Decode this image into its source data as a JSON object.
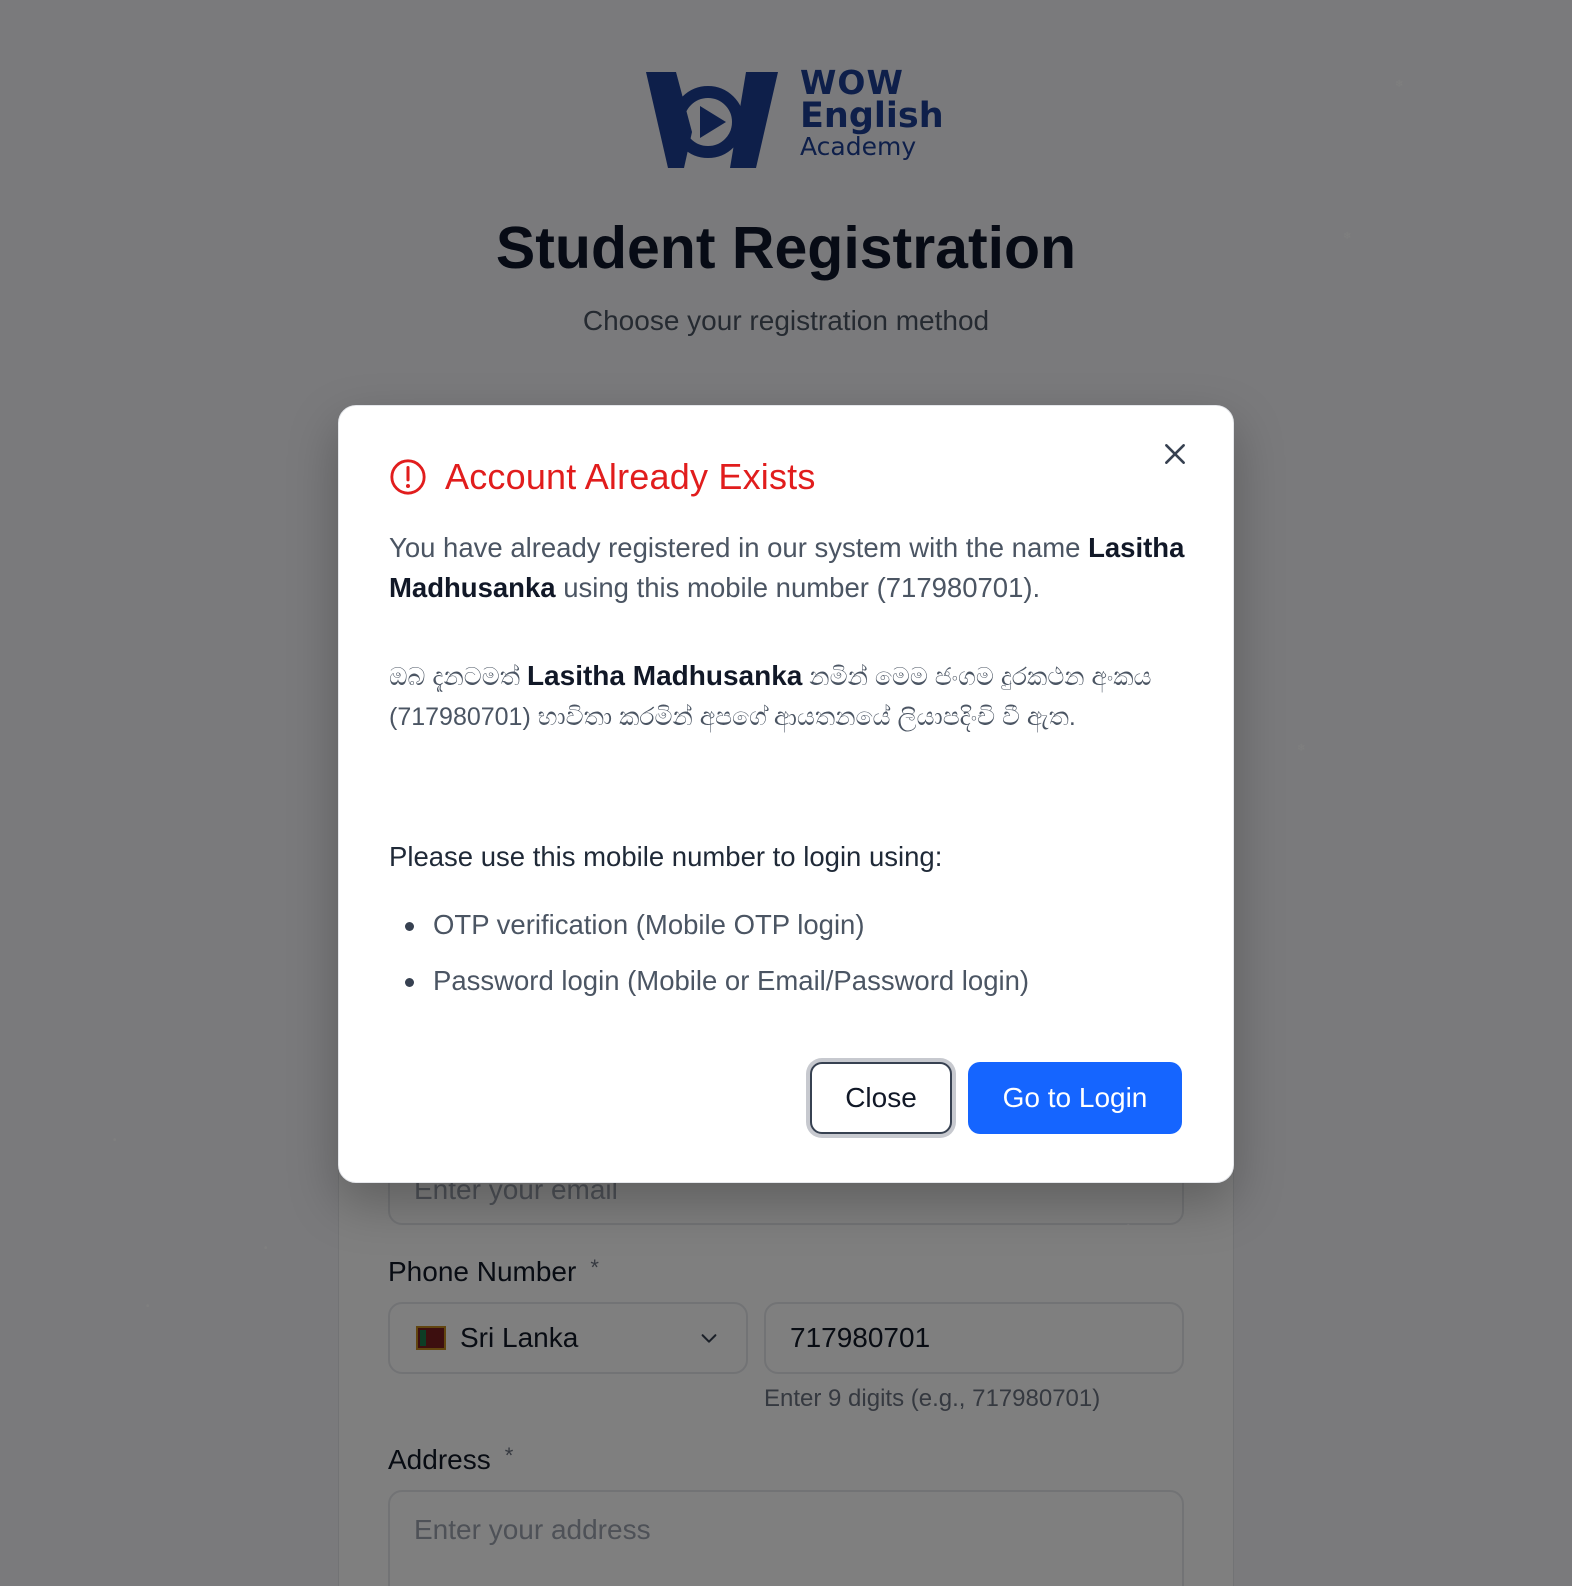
{
  "brand": {
    "line1": "WOW",
    "line2": "English",
    "line3": "Academy",
    "color": "#1d3f95"
  },
  "page": {
    "title": "Student Registration",
    "subtitle": "Choose your registration method"
  },
  "form": {
    "email_placeholder": "Enter your email",
    "phone_label": "Phone Number",
    "required_mark": "*",
    "country_selected": "Sri Lanka",
    "phone_value": "717980701",
    "phone_hint": "Enter 9 digits (e.g., 717980701)",
    "address_label": "Address",
    "address_placeholder": "Enter your address"
  },
  "modal": {
    "title": "Account Already Exists",
    "title_color": "#e11d1d",
    "en_before": "You have already registered in our system with the name ",
    "name": "Lasitha Madhusanka",
    "en_after": " using this mobile number (717980701).",
    "si_before": "ඔබ දැනටමත් ",
    "si_after": " නමින් මෙම ජංගම දුරකථන අංකය (717980701) භාවිතා කරමින් අපගේ ආයතනයේ ලියාපදිංචි වී ඇත.",
    "use_text": "Please use this mobile number to login using:",
    "methods": [
      "OTP verification (Mobile OTP login)",
      "Password login (Mobile or Email/Password login)"
    ],
    "close_label": "Close",
    "login_label": "Go to Login",
    "login_color": "#1565ff"
  },
  "icons": {
    "alert": "alert-circle-icon",
    "close": "close-icon",
    "chevron": "chevron-down-icon",
    "flag": "sri-lanka-flag-icon"
  }
}
